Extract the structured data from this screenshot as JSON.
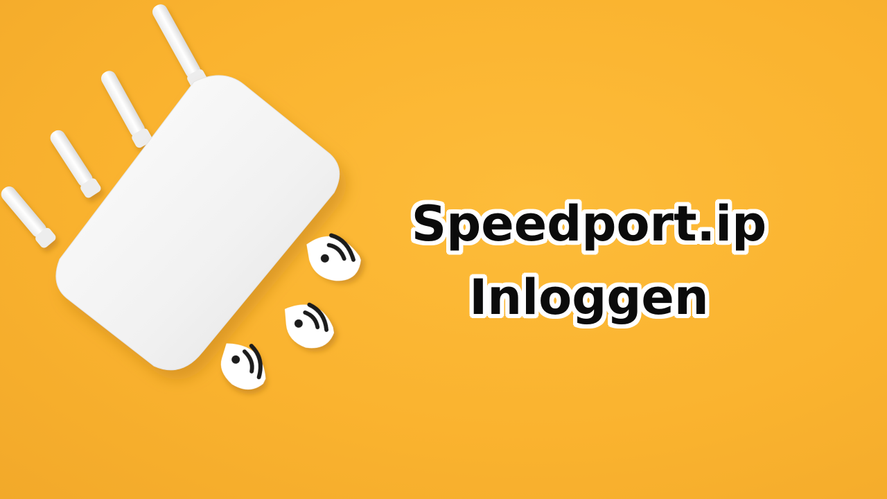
{
  "headline": {
    "line1": "Speedport.ip",
    "line2": "Inloggen"
  },
  "colors": {
    "background": "#FBB533",
    "router": "#F4F4F4",
    "text": "#0B0B0B",
    "text_outline": "#FFFFFF"
  },
  "icons": [
    "router-illustration",
    "wifi-signal-icon",
    "wifi-signal-icon",
    "wifi-signal-icon"
  ]
}
